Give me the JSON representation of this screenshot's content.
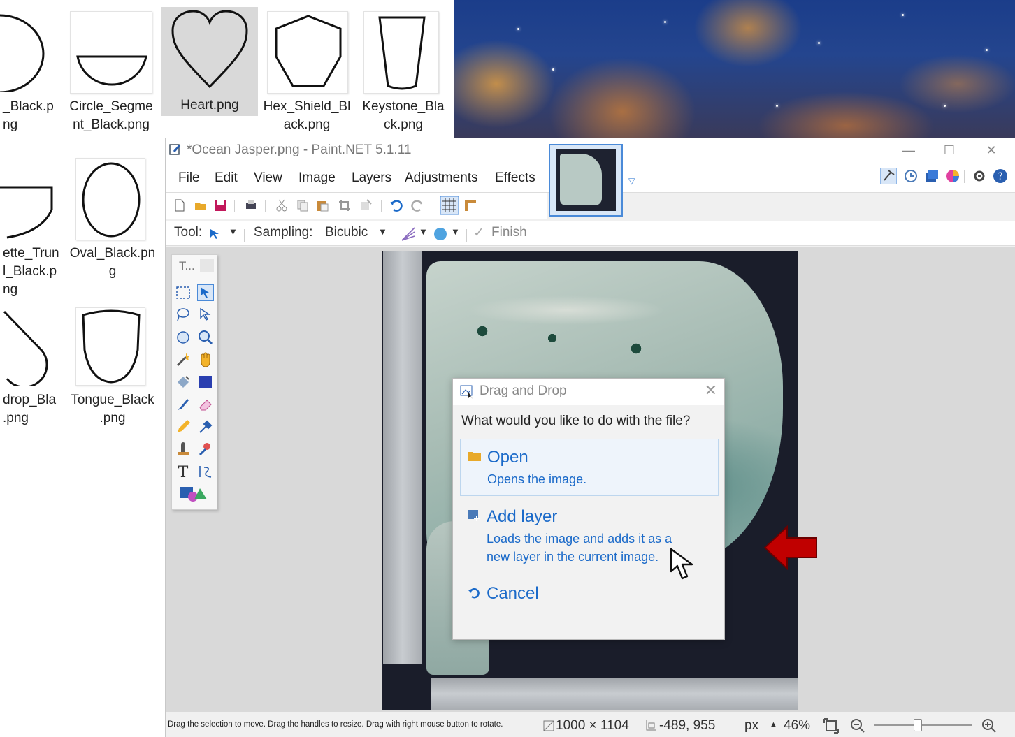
{
  "desktop": {
    "files": [
      {
        "name": "file-partial-black",
        "label": "_Black.p\nng"
      },
      {
        "name": "file-circle-segment",
        "label": "Circle_Segme\nnt_Black.png"
      },
      {
        "name": "file-heart",
        "label": "Heart.png"
      },
      {
        "name": "file-hex-shield",
        "label": "Hex_Shield_Bl\nack.png"
      },
      {
        "name": "file-keystone",
        "label": "Keystone_Bla\nck.png"
      },
      {
        "name": "file-rosette-truncated",
        "label": "ette_Trun\nl_Black.p\nng"
      },
      {
        "name": "file-oval",
        "label": "Oval_Black.pn\ng"
      },
      {
        "name": "file-teardrop",
        "label": "drop_Bla\n.png"
      },
      {
        "name": "file-tongue",
        "label": "Tongue_Black\n.png"
      }
    ]
  },
  "window": {
    "title": "*Ocean Jasper.png - Paint.NET 5.1.11",
    "controls": {
      "minimize": "—",
      "maximize": "☐",
      "close": "✕"
    }
  },
  "menu": [
    "File",
    "Edit",
    "View",
    "Image",
    "Layers",
    "Adjustments",
    "Effects"
  ],
  "tool_options": {
    "tool_label": "Tool:",
    "sampling_label": "Sampling:",
    "sampling_value": "Bicubic",
    "finish": "Finish"
  },
  "tools_palette": {
    "title": "T..."
  },
  "dialog": {
    "title": "Drag and Drop",
    "question": "What would you like to do with the file?",
    "open": {
      "label": "Open",
      "desc": "Opens the image."
    },
    "add_layer": {
      "label": "Add layer",
      "desc": "Loads the image and adds it as a\nnew layer in the current image."
    },
    "cancel": {
      "label": "Cancel"
    }
  },
  "statusbar": {
    "message": "Drag the selection to move. Drag the handles to resize. Drag with right mouse button to rotate.",
    "image_size": "1000 × 1104",
    "cursor_pos": "-489, 955",
    "units": "px",
    "zoom": "46%"
  },
  "colors": {
    "accent": "#1b6ac9",
    "highlight_arrow": "#c00000"
  }
}
